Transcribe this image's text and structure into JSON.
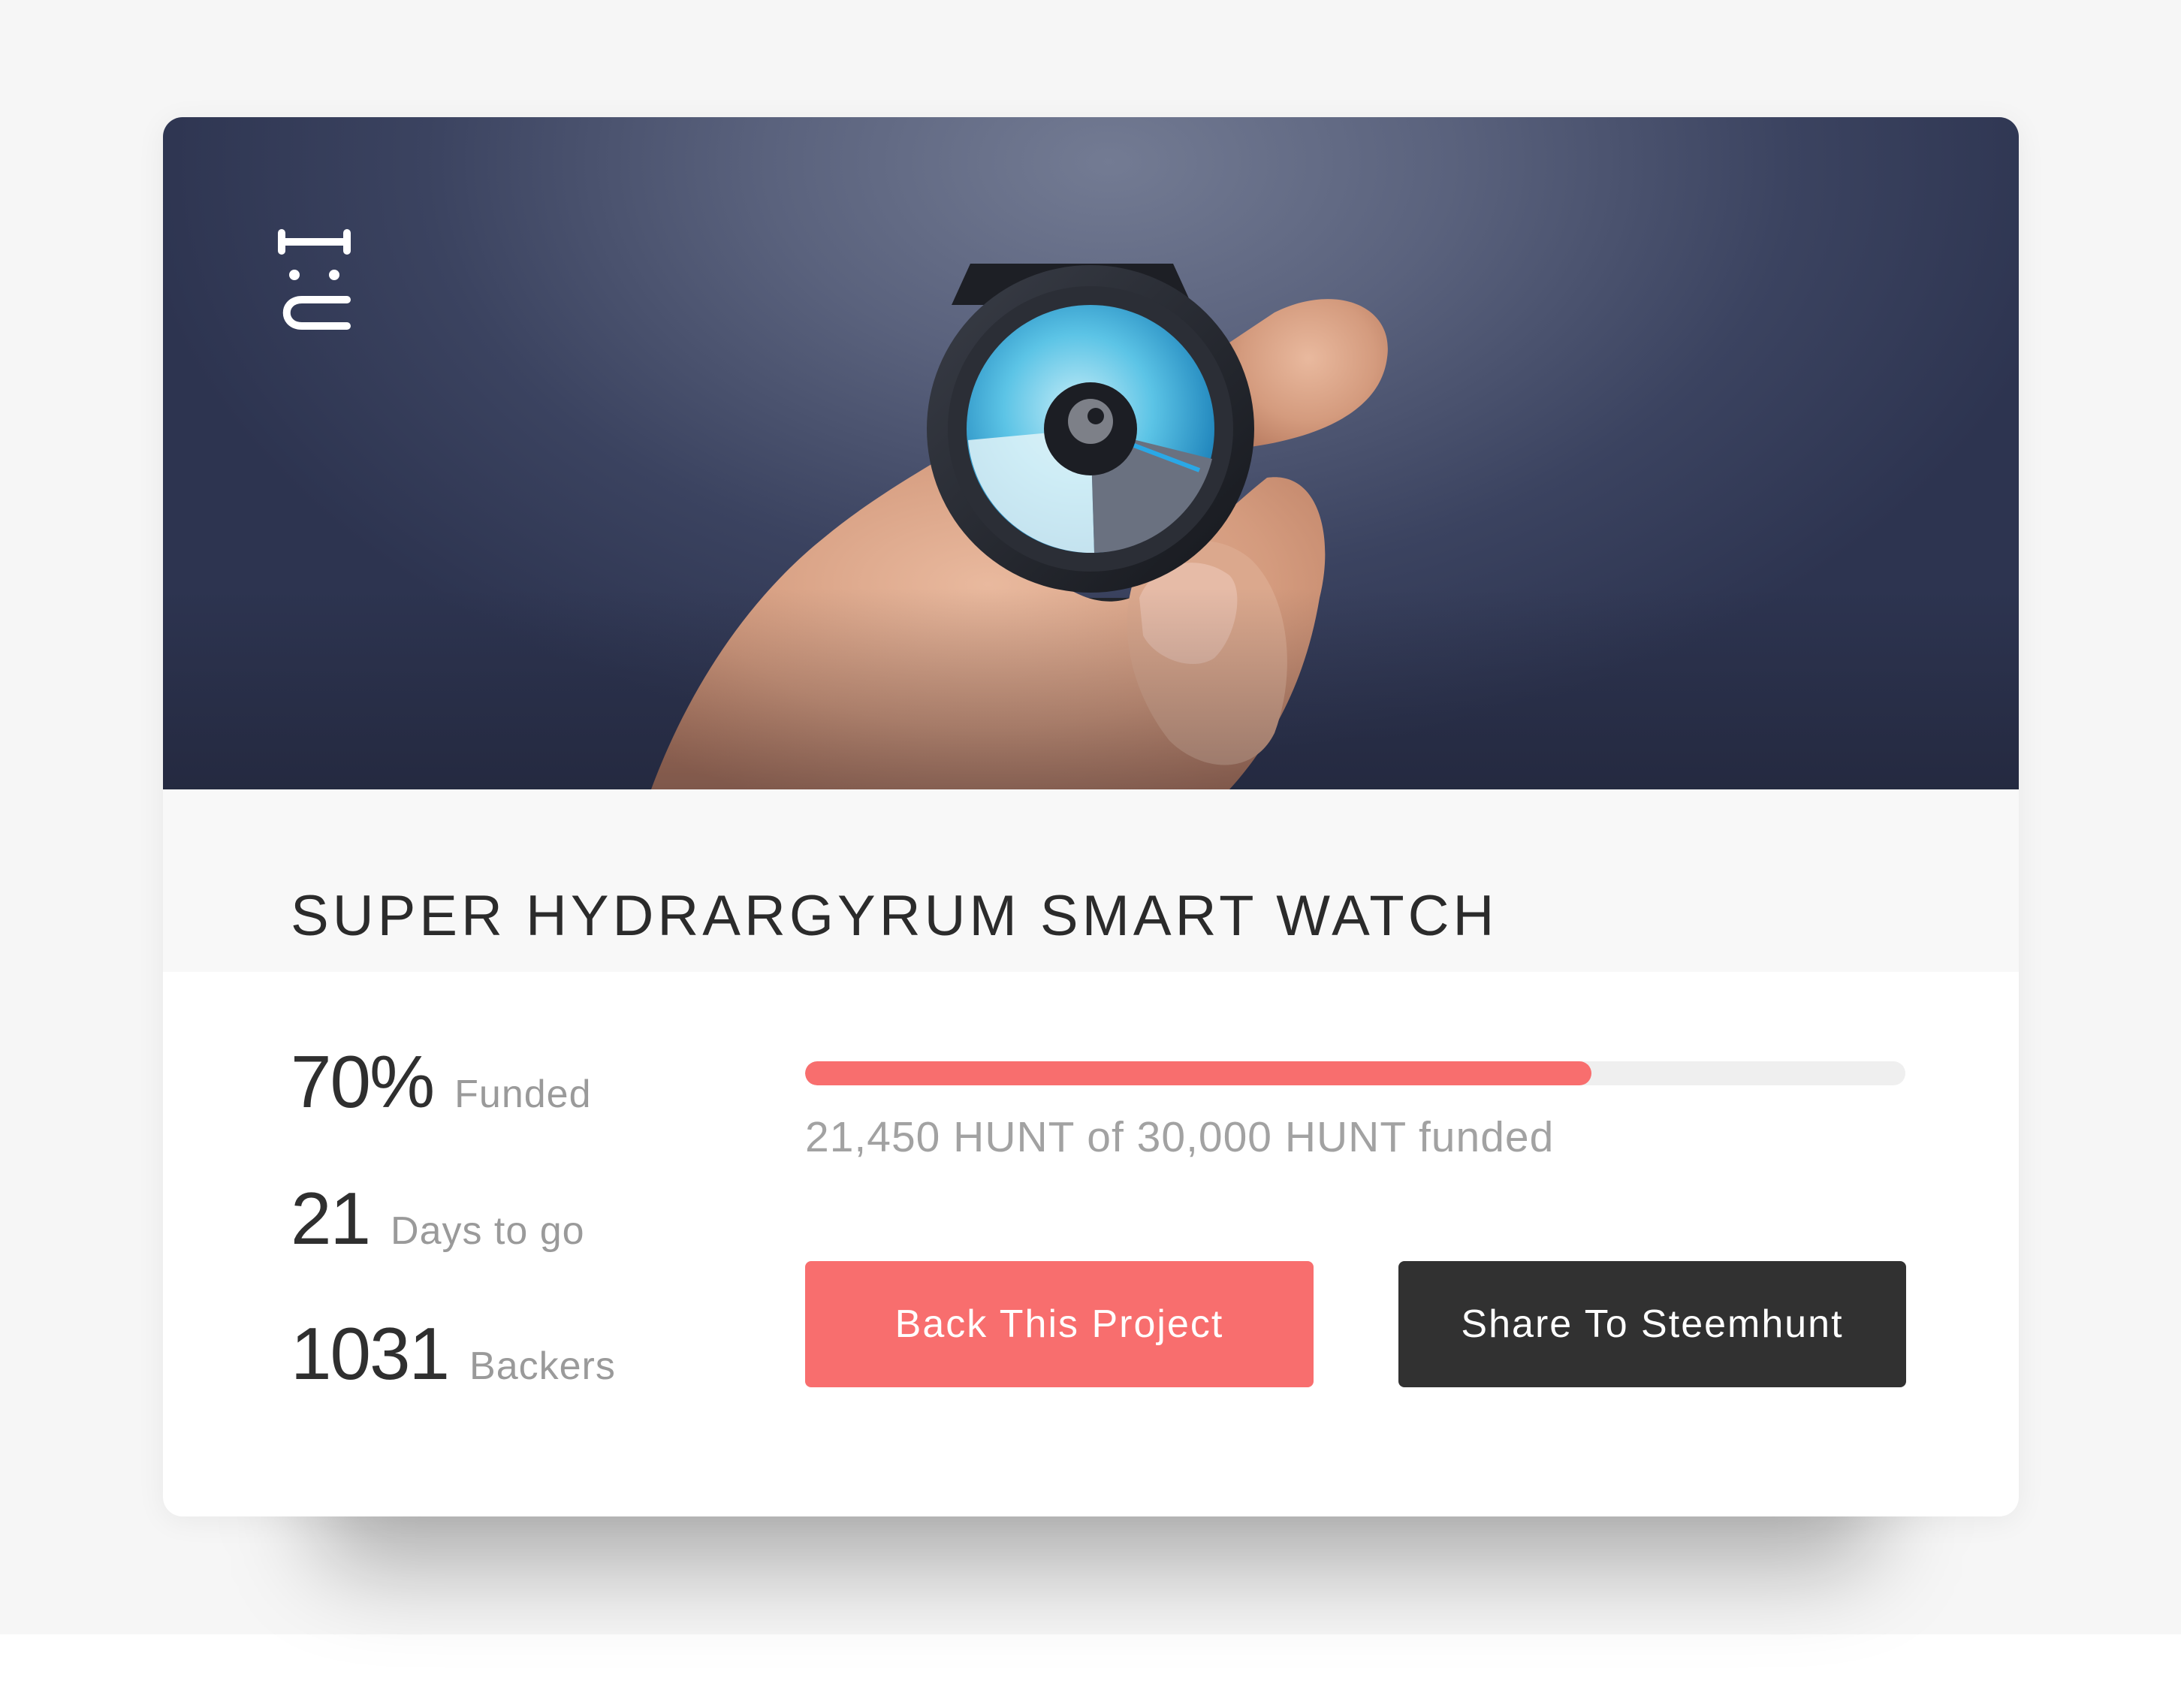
{
  "brand": {
    "logo_text": "h:I"
  },
  "project": {
    "title": "SUPER HYDRARGYRUM SMART WATCH"
  },
  "stats": [
    {
      "value": "70%",
      "label": "Funded"
    },
    {
      "value": "21",
      "label": "Days to go"
    },
    {
      "value": "1031",
      "label": "Backers"
    }
  ],
  "funding": {
    "progress_fraction": 0.715,
    "summary": "21,450 HUNT of 30,000 HUNT funded"
  },
  "actions": {
    "back_label": "Back This Project",
    "share_label": "Share To Steemhunt"
  },
  "colors": {
    "accent": "#f86e6e",
    "dark_button": "#313131",
    "background": "#f6f6f6"
  },
  "icons": {
    "logo": "steemhunt-logo-icon",
    "hero": "smartwatch-photo"
  }
}
